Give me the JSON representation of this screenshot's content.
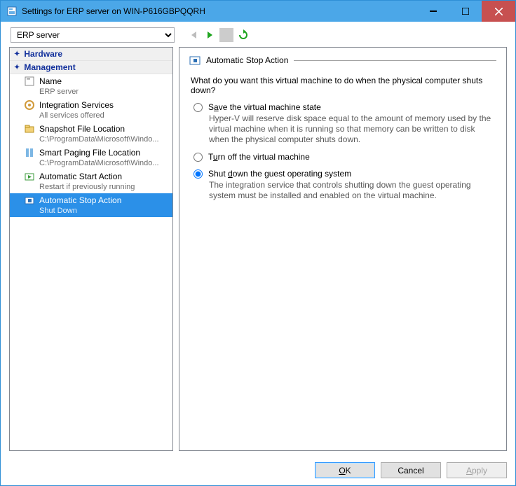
{
  "window": {
    "title": "Settings for ERP server on WIN-P616GBPQQRH"
  },
  "toolbar": {
    "selector_value": "ERP server"
  },
  "sidebar": {
    "group_hardware": "Hardware",
    "group_management": "Management",
    "items": [
      {
        "label": "Name",
        "sub": "ERP server"
      },
      {
        "label": "Integration Services",
        "sub": "All services offered"
      },
      {
        "label": "Snapshot File Location",
        "sub": "C:\\ProgramData\\Microsoft\\Windo..."
      },
      {
        "label": "Smart Paging File Location",
        "sub": "C:\\ProgramData\\Microsoft\\Windo..."
      },
      {
        "label": "Automatic Start Action",
        "sub": "Restart if previously running"
      },
      {
        "label": "Automatic Stop Action",
        "sub": "Shut Down"
      }
    ]
  },
  "content": {
    "header": "Automatic Stop Action",
    "prompt": "What do you want this virtual machine to do when the physical computer shuts down?",
    "opt1_pre": "S",
    "opt1_mid": "a",
    "opt1_post": "ve the virtual machine state",
    "opt1_desc": "Hyper-V will reserve disk space equal to the amount of memory used by the virtual machine when it is running so that memory can be written to disk when the physical computer shuts down.",
    "opt2_pre": "T",
    "opt2_mid": "u",
    "opt2_post": "rn off the virtual machine",
    "opt3_pre": "Shut ",
    "opt3_mid": "d",
    "opt3_post": "own the guest operating system",
    "opt3_desc": "The integration service that controls shutting down the guest operating system must be installed and enabled on the virtual machine."
  },
  "footer": {
    "ok_pre": "O",
    "ok_mid": "K",
    "cancel": "Cancel",
    "apply_pre": "A",
    "apply_mid": "pply"
  }
}
